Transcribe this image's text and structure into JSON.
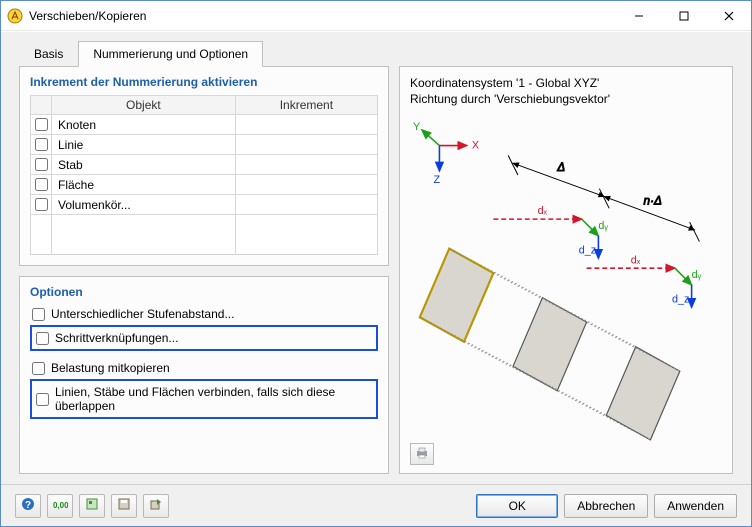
{
  "window": {
    "title": "Verschieben/Kopieren"
  },
  "tabs": {
    "basis": "Basis",
    "numbering": "Nummerierung und Optionen"
  },
  "increment_group": {
    "title": "Inkrement der Nummerierung aktivieren",
    "columns": {
      "object": "Objekt",
      "increment": "Inkrement"
    },
    "rows": [
      {
        "label": "Knoten"
      },
      {
        "label": "Linie"
      },
      {
        "label": "Stab"
      },
      {
        "label": "Fläche"
      },
      {
        "label": "Volumenkör..."
      }
    ]
  },
  "options_group": {
    "title": "Optionen",
    "opt1": "Unterschiedlicher Stufenabstand...",
    "opt2": "Schrittverknüpfungen...",
    "opt3": "Belastung mitkopieren",
    "opt4": "Linien, Stäbe und Flächen verbinden, falls sich diese überlappen"
  },
  "preview": {
    "line1": "Koordinatensystem '1 - Global XYZ'",
    "line2": "Richtung durch 'Verschiebungsvektor'",
    "axes": {
      "x": "X",
      "y": "Y",
      "z": "Z"
    },
    "labels": {
      "delta": "Δ",
      "ndelta": "n·Δ",
      "dx": "dₓ",
      "dy": "dᵧ",
      "dz": "d_z"
    }
  },
  "buttons": {
    "ok": "OK",
    "cancel": "Abbrechen",
    "apply": "Anwenden"
  }
}
